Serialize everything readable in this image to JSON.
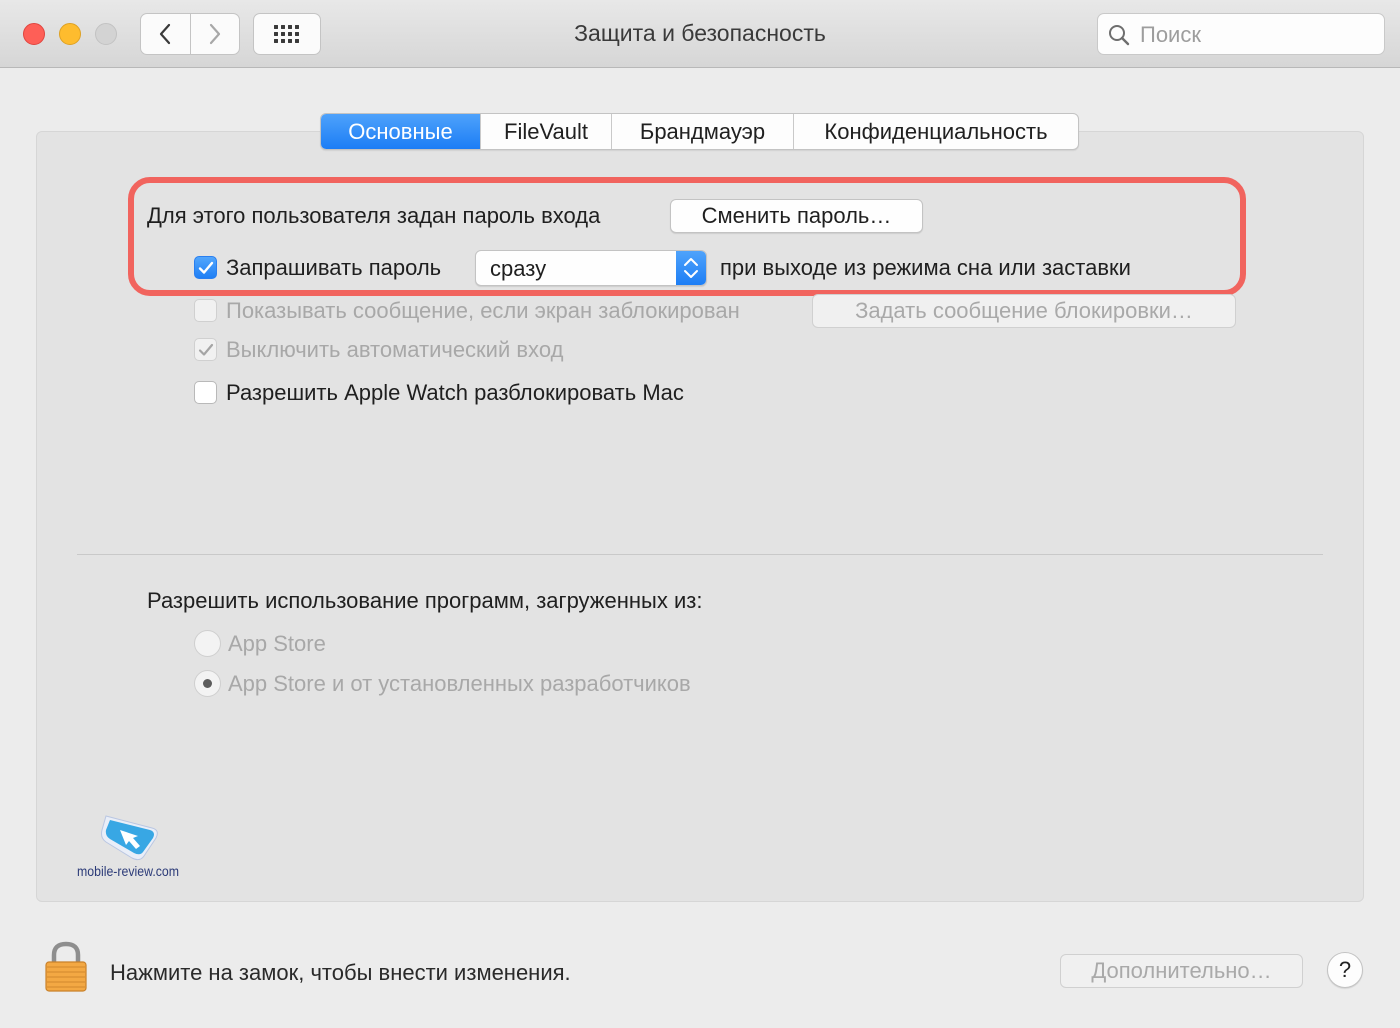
{
  "window": {
    "title": "Защита и безопасность",
    "search_placeholder": "Поиск"
  },
  "tabs": [
    {
      "label": "Основные",
      "active": true
    },
    {
      "label": "FileVault",
      "active": false
    },
    {
      "label": "Брандмауэр",
      "active": false
    },
    {
      "label": "Конфиденциальность",
      "active": false
    }
  ],
  "general": {
    "password_set_text": "Для этого пользователя задан пароль входа",
    "change_password_button": "Сменить пароль…",
    "require_password": {
      "label": "Запрашивать пароль",
      "checked": true
    },
    "require_password_delay": "сразу",
    "require_password_suffix": "при выходе из режима сна или заставки",
    "show_message": {
      "label": "Показывать сообщение, если экран заблокирован",
      "checked": false,
      "enabled": false
    },
    "set_lock_message_button": "Задать сообщение блокировки…",
    "disable_auto_login": {
      "label": "Выключить автоматический вход",
      "checked": true,
      "enabled": false
    },
    "apple_watch_unlock": {
      "label": "Разрешить Apple Watch разблокировать Mac",
      "checked": false
    }
  },
  "downloads": {
    "heading": "Разрешить использование программ, загруженных из:",
    "options": [
      {
        "label": "App Store",
        "selected": false
      },
      {
        "label": "App Store и от установленных разработчиков",
        "selected": true
      }
    ]
  },
  "watermark": {
    "text": "mobile-review.com"
  },
  "footer": {
    "lock_text": "Нажмите на замок, чтобы внести изменения.",
    "advanced_button": "Дополнительно…",
    "help_button": "?"
  },
  "colors": {
    "accent": "#1c7df5",
    "highlight_border": "#f1645e",
    "close": "#fe5f57",
    "minimize": "#febc2e"
  }
}
